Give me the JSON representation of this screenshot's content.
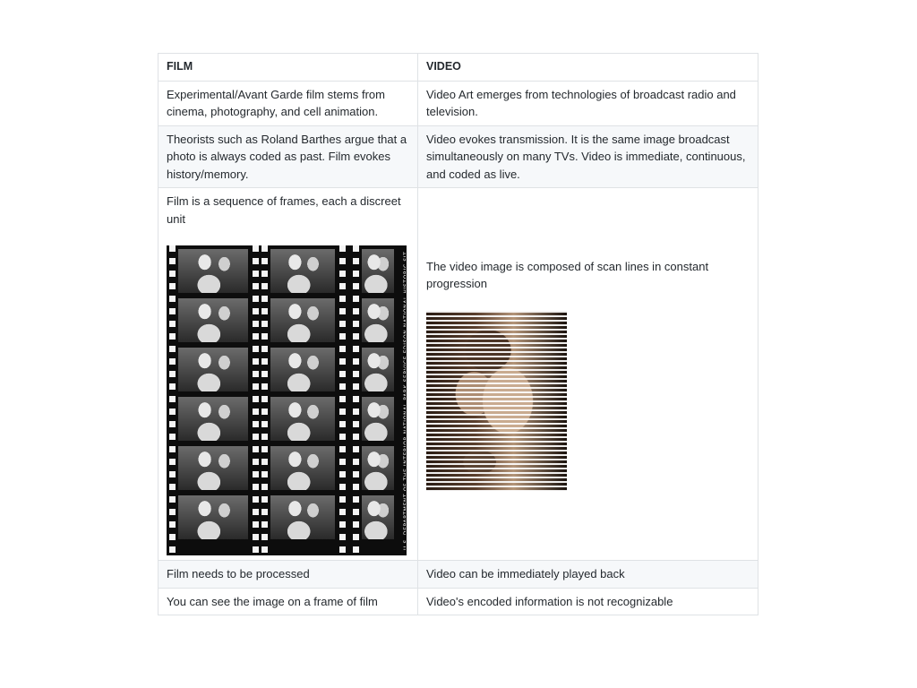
{
  "table": {
    "headers": [
      "FILM",
      "VIDEO"
    ],
    "rows": [
      {
        "film": "Experimental/Avant Garde film stems from cinema, photography, and cell animation.",
        "video": "Video Art emerges from technologies of broadcast radio and television."
      },
      {
        "film": "Theorists such as Roland Barthes argue that a photo is always coded as past. Film evokes history/memory.",
        "video": "Video evokes transmission. It is the same image broadcast simultaneously on many TVs. Video is immediate, continuous, and coded as live."
      },
      {
        "film": "Film is a sequence of frames, each a discreet unit",
        "video": "The video image is composed of scan lines in constant progression",
        "film_image_caption": "U.S. DEPARTMENT OF THE INTERIOR NATIONAL PARK SERVICE EDISON NATIONAL HISTORIC SITE"
      },
      {
        "film": "Film needs to be processed",
        "video": "Video can be immediately played back"
      },
      {
        "film": "You can see the image on a frame of film",
        "video": "Video's encoded information is not recognizable"
      }
    ]
  }
}
